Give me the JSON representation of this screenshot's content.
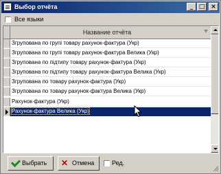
{
  "window": {
    "title": "Выбор отчёта",
    "controls": {
      "minimize": "_",
      "maximize": "□",
      "close": "×"
    }
  },
  "filter": {
    "all_languages_label": "Все языки",
    "all_languages_checked": false
  },
  "grid": {
    "column_header": "Название отчёта",
    "rows": [
      {
        "label": "Згрупована по групі товару рахунок-фактура (Укр)",
        "selected": false
      },
      {
        "label": "Згрупована по групі товару рахунок-фактура Велика (Укр)",
        "selected": false
      },
      {
        "label": "Згрупована по підтипу товару рахунок-фактура (Укр)",
        "selected": false
      },
      {
        "label": "Згрупована по підтипу товару рахунок-фактура Велика (Укр)",
        "selected": false
      },
      {
        "label": "Згрупована по товару рахунок-фактура (Укр)",
        "selected": false
      },
      {
        "label": "Згрупована по товару рахунок-фактура Велика (Укр)",
        "selected": false
      },
      {
        "label": "Рахунок-фактура (Укр)",
        "selected": false
      },
      {
        "label": "Рахунок-фактура Велика (Укр)",
        "selected": true
      }
    ]
  },
  "buttons": {
    "select_label": "Выбрать",
    "cancel_label": "Отмена",
    "edit_label": "Ред."
  },
  "colors": {
    "title_bar": "#0a246a",
    "selection": "#0a246a",
    "face": "#d4d0c8"
  }
}
